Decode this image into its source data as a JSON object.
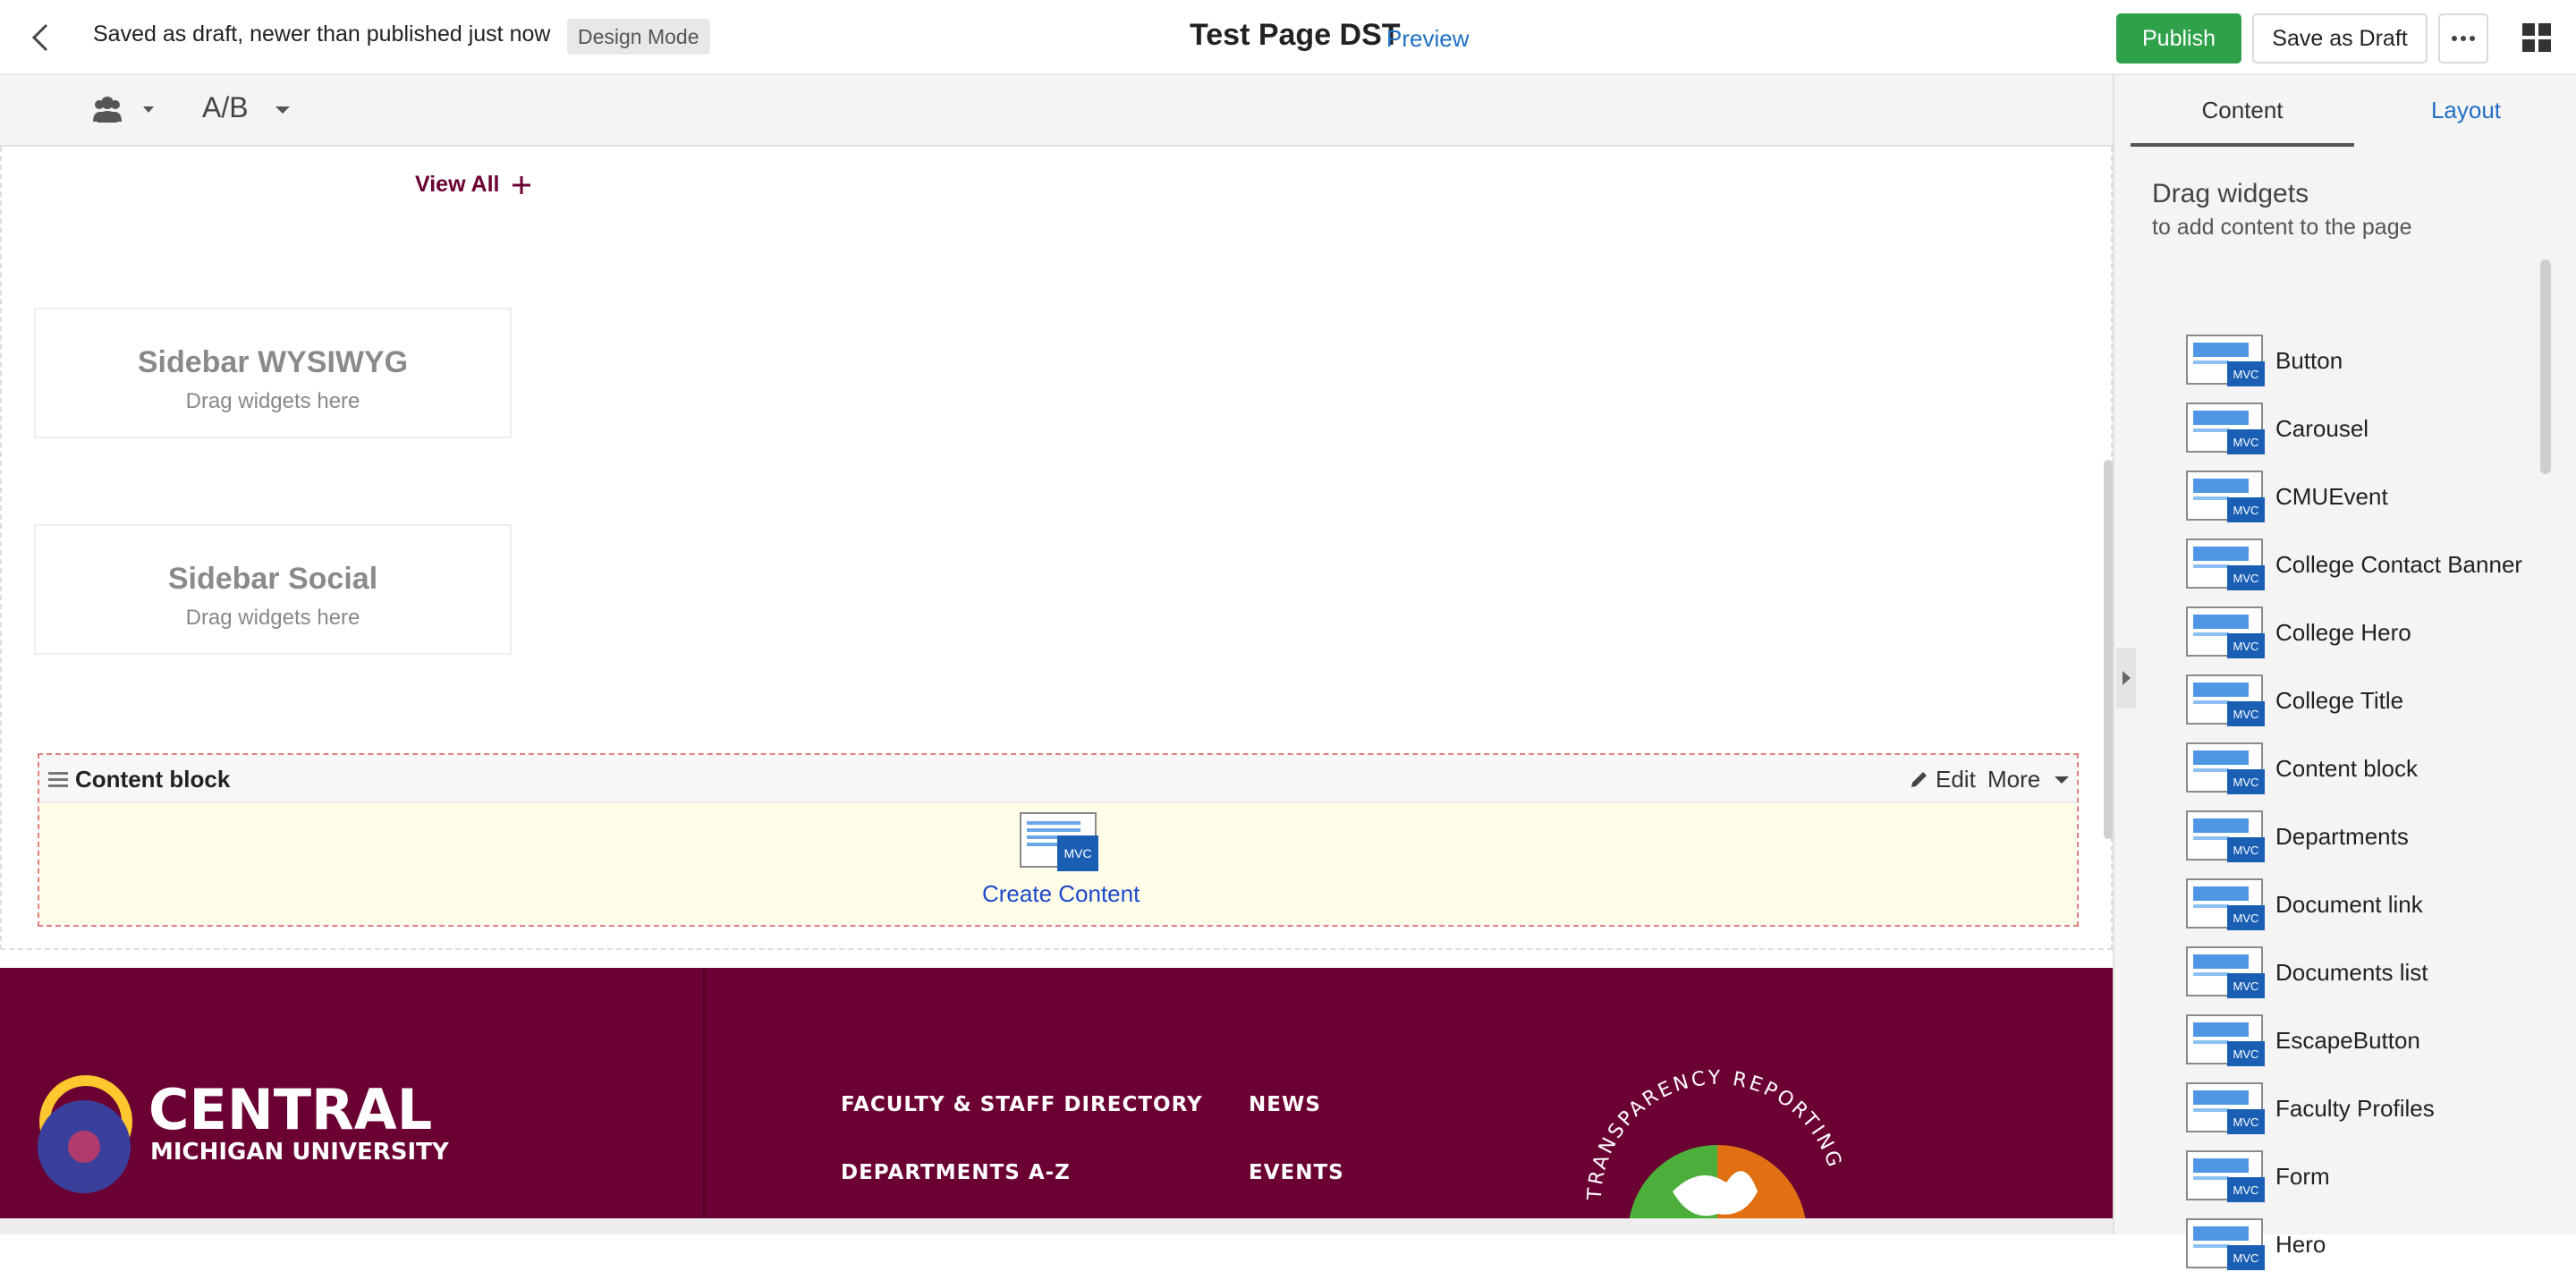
{
  "header": {
    "status": "Saved as draft, newer than published just now",
    "mode_badge": "Design Mode",
    "page_title": "Test Page DST",
    "preview_label": "Preview",
    "publish_label": "Publish",
    "save_draft_label": "Save as Draft"
  },
  "toolbar": {
    "ab_label": "A/B"
  },
  "canvas": {
    "view_all_label": "View All",
    "sidebar_wysiwyg": {
      "title": "Sidebar WYSIWYG",
      "hint": "Drag widgets here"
    },
    "sidebar_social": {
      "title": "Sidebar Social",
      "hint": "Drag widgets here"
    },
    "content_block": {
      "label": "Content block",
      "edit_label": "Edit",
      "more_label": "More",
      "create_label": "Create Content",
      "icon_badge": "MVC"
    }
  },
  "footer": {
    "logo_line1": "CENTRAL",
    "logo_line2": "MICHIGAN UNIVERSITY",
    "links": [
      "FACULTY & STAFF DIRECTORY",
      "NEWS",
      "DEPARTMENTS A-Z",
      "EVENTS"
    ],
    "transparency_text": "TRANSPARENCY REPORTING"
  },
  "panel": {
    "tabs": [
      "Content",
      "Layout"
    ],
    "heading": "Drag widgets",
    "subheading": "to add content to the page",
    "badge": "MVC",
    "widgets": [
      "Button",
      "Carousel",
      "CMUEvent",
      "College Contact Banner",
      "College Hero",
      "College Title",
      "Content block",
      "Departments",
      "Document link",
      "Documents list",
      "EscapeButton",
      "Faculty Profiles",
      "Form",
      "Hero"
    ]
  },
  "colors": {
    "brand_maroon": "#6b0032",
    "publish_green": "#2fa14b",
    "link_blue": "#1f6fc5",
    "mvc_blue": "#1a5fb4"
  }
}
